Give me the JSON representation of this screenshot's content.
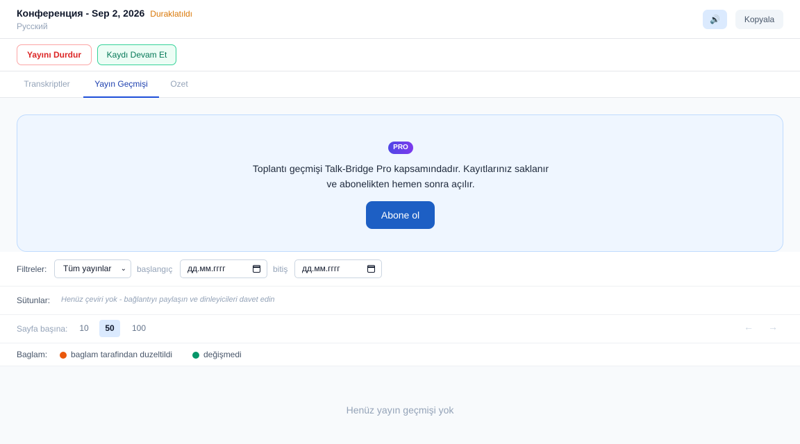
{
  "header": {
    "title": "Конференция - Sep 2, 2026",
    "status": "Duraklatıldı",
    "language": "Русский",
    "sound_icon": "speaker-icon",
    "copy_label": "Kopyala"
  },
  "actions": {
    "stop_label": "Yayını Durdur",
    "resume_label": "Kaydı Devam Et"
  },
  "tabs": [
    {
      "label": "Transkriptler",
      "active": false
    },
    {
      "label": "Yayın Geçmişi",
      "active": true
    },
    {
      "label": "Ozet",
      "active": false
    }
  ],
  "pro": {
    "badge": "PRO",
    "line1": "Toplantı geçmişi Talk-Bridge Pro kapsamındadır. Kayıtlarınız saklanır",
    "line2": "ve abonelikten hemen sonra açılır.",
    "button": "Abone ol"
  },
  "filters": {
    "label": "Filtreler:",
    "select_value": "Tüm yayınlar",
    "start_label": "başlangıç",
    "start_placeholder": "дд.мм.гггг",
    "end_label": "bitiş",
    "end_placeholder": "дд.мм.гггг"
  },
  "columns": {
    "label": "Sütunlar:",
    "empty_text": "Henüz çeviri yok - bağlantıyı paylaşın ve dinleyicileri davet edin"
  },
  "paging": {
    "label": "Sayfa başına:",
    "options": [
      "10",
      "50",
      "100"
    ],
    "selected": "50",
    "prev": "←",
    "next": "→"
  },
  "context": {
    "label": "Baglam:",
    "legend": [
      {
        "label": "baglam tarafindan duzeltildi",
        "color": "#ea580c"
      },
      {
        "label": "değişmedi",
        "color": "#059669"
      }
    ]
  },
  "empty_state": "Henüz yayın geçmişi yok"
}
